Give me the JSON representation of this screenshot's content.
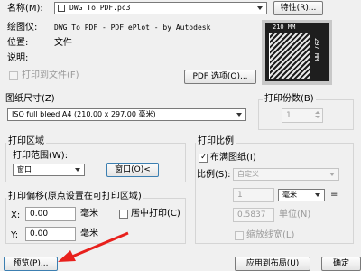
{
  "printer": {
    "name_label": "名称(M):",
    "name_value": "DWG To PDF.pc3",
    "properties_button": "特性(R)...",
    "plotter_label": "绘图仪:",
    "plotter_value": "DWG To PDF - PDF ePlot - by Autodesk",
    "location_label": "位置:",
    "location_value": "文件",
    "description_label": "说明:",
    "print_to_file": "打印到文件(F)",
    "pdf_options_button": "PDF 选项(O)...",
    "preview_width": "210 MM",
    "preview_height": "297 MM"
  },
  "paper_size": {
    "label": "图纸尺寸(Z)",
    "value": "ISO full bleed A4 (210.00 x 297.00 毫米)"
  },
  "copies": {
    "label": "打印份数(B)",
    "value": "1"
  },
  "plot_area": {
    "label": "打印区域",
    "range_label": "打印范围(W):",
    "range_value": "窗口",
    "window_button": "窗口(O)<"
  },
  "plot_scale": {
    "label": "打印比例",
    "fit_label": "布满图纸(I)",
    "scale_label": "比例(S):",
    "scale_value": "自定义",
    "value1": "1",
    "unit_value": "毫米",
    "equals": "=",
    "value2": "0.5837",
    "unit_label": "单位(N)",
    "scale_lineweights": "缩放线宽(L)"
  },
  "plot_offset": {
    "label": "打印偏移(原点设置在可打印区域)",
    "x_label": "X:",
    "x_value": "0.00",
    "x_unit": "毫米",
    "y_label": "Y:",
    "y_value": "0.00",
    "y_unit": "毫米",
    "center_label": "居中打印(C)"
  },
  "footer": {
    "preview_button": "预览(P)...",
    "apply_layout_button": "应用到布局(U)",
    "ok_button": "确定"
  },
  "colors": {
    "annotation_arrow": "#e8201c"
  }
}
